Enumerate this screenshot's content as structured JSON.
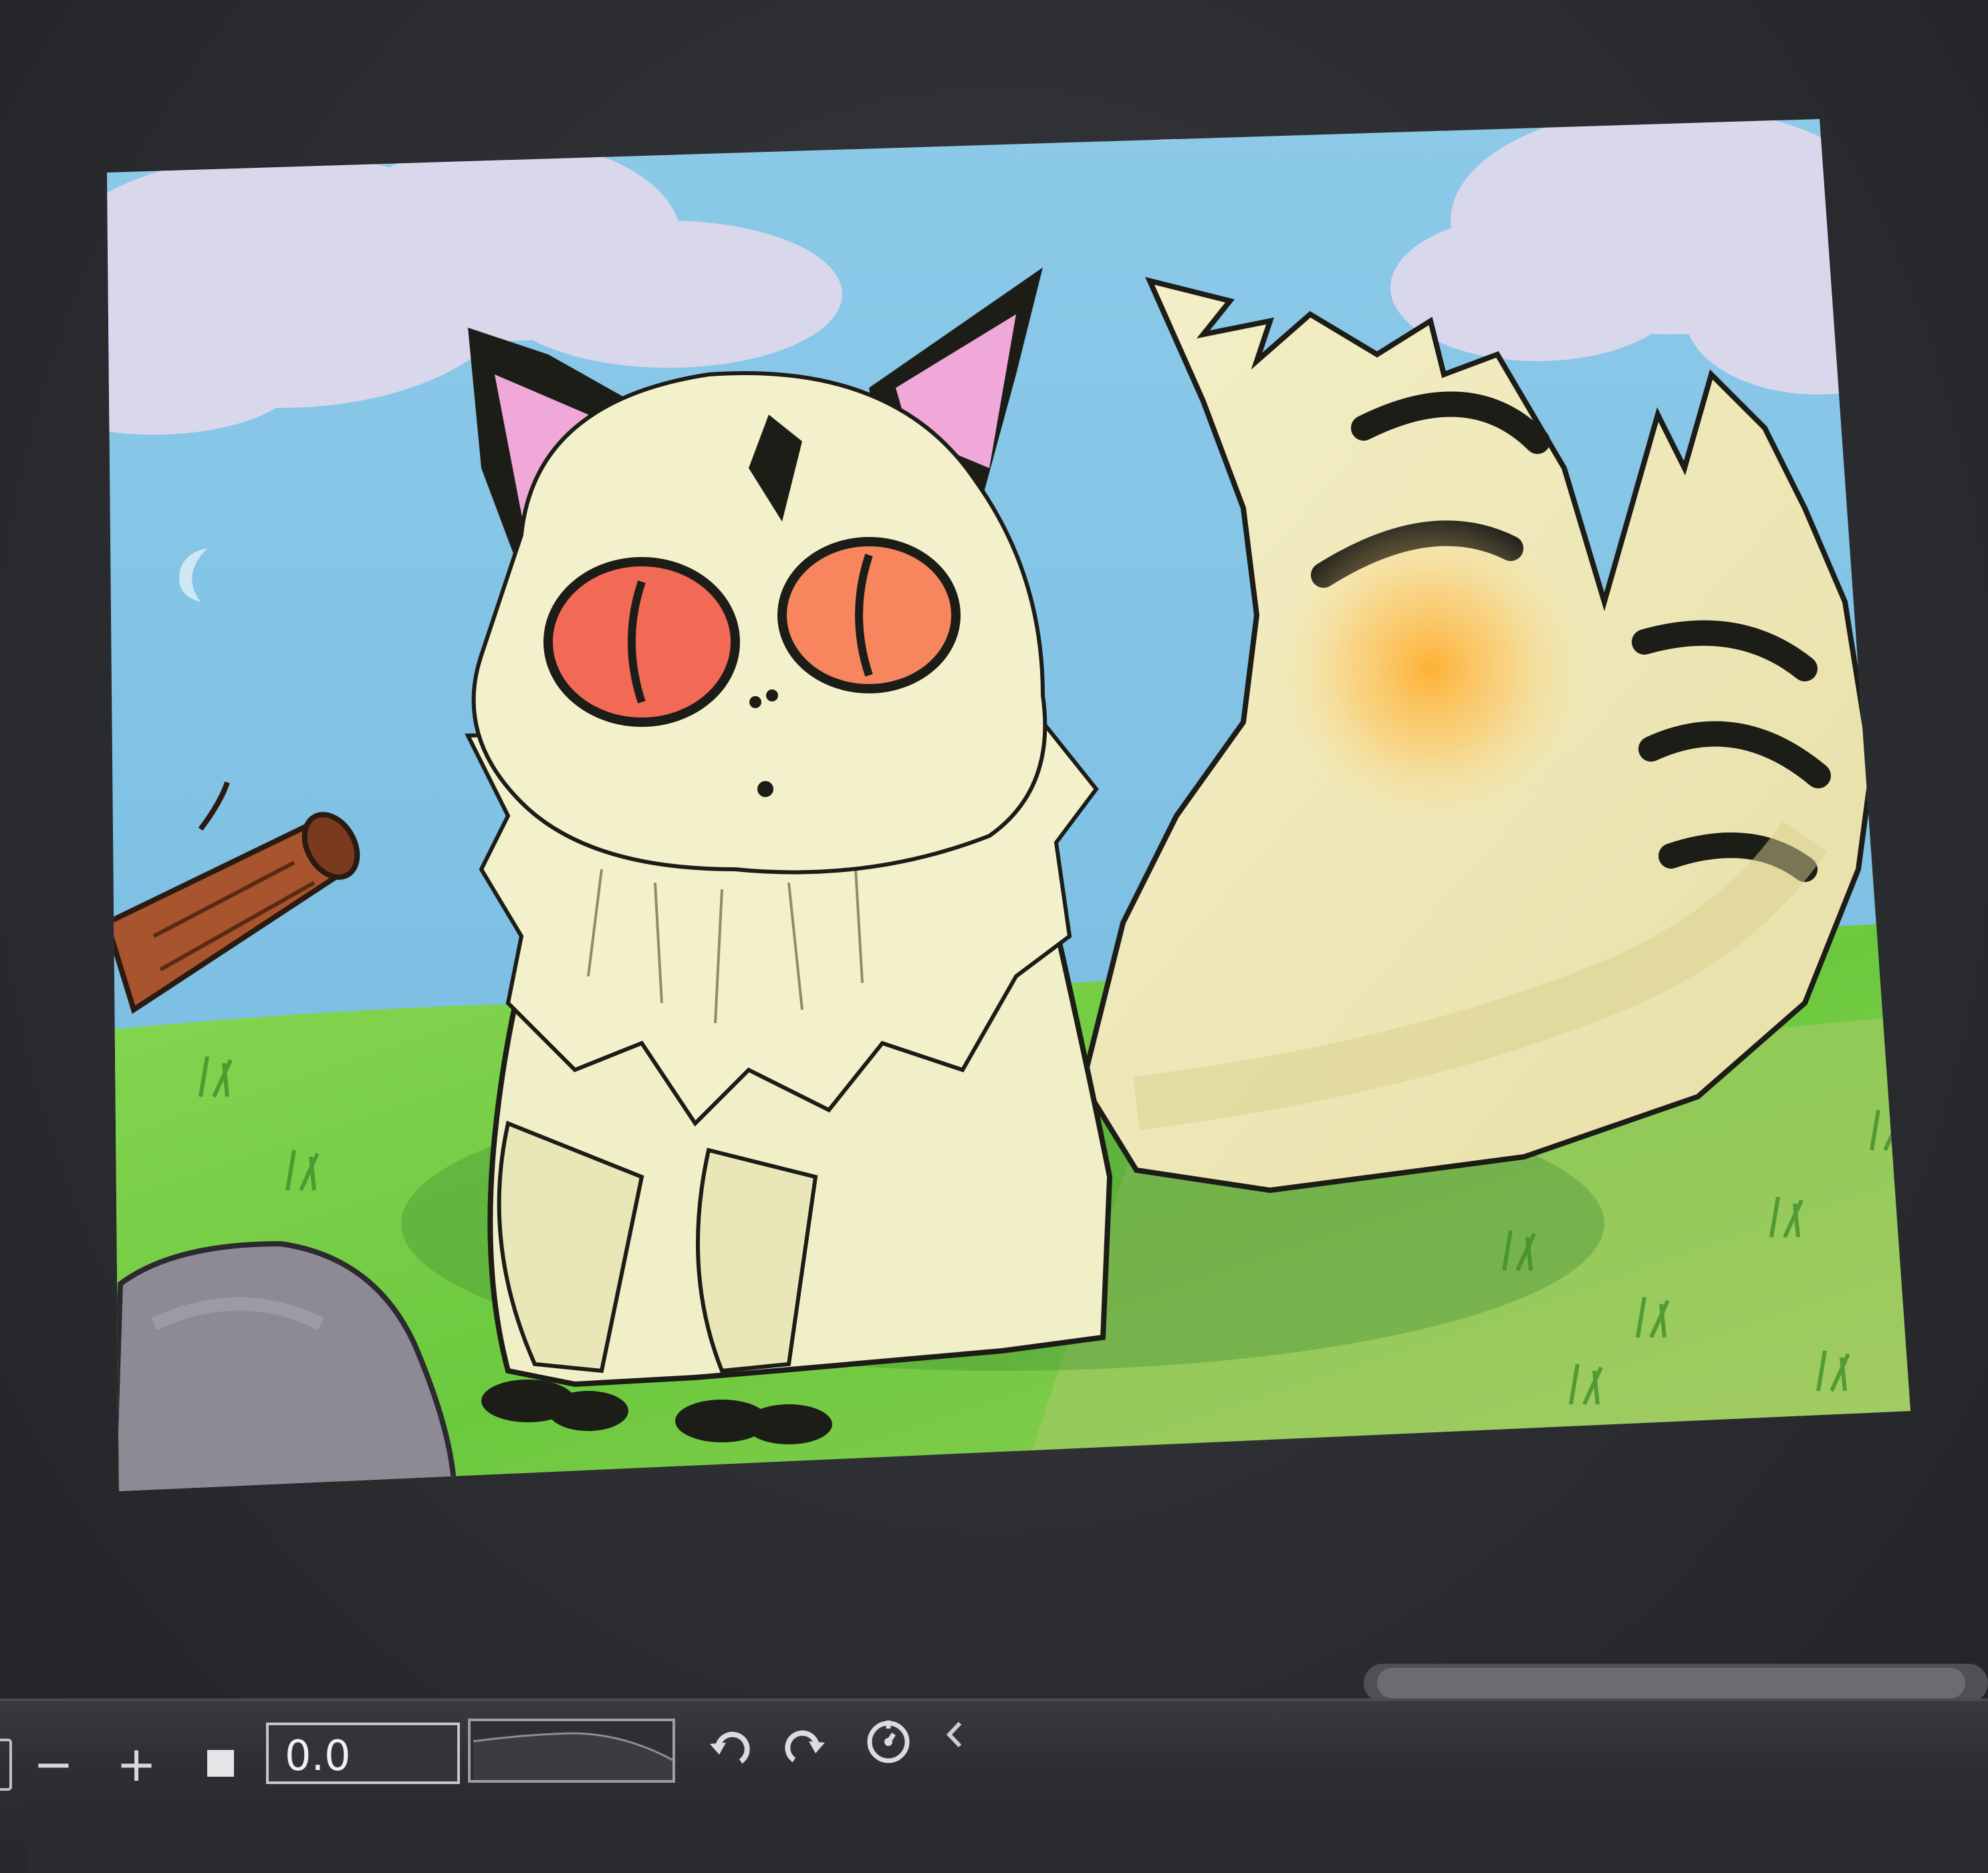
{
  "toolbar": {
    "zoom_out_label": "−",
    "zoom_in_label": "+",
    "value": "0.0"
  },
  "icons": {
    "zoom_out": "minus-icon",
    "zoom_in": "plus-icon",
    "stop": "stop-icon",
    "undo": "undo-icon",
    "redo": "redo-icon",
    "timer": "timer-icon",
    "collapse": "chevron-left-icon"
  },
  "colors": {
    "sky": "#7fc3e6",
    "grass": "#7fd04a",
    "fur": "#f2f0c6",
    "eyes": "#f26a56",
    "ears_inner": "#f0a8d8"
  }
}
